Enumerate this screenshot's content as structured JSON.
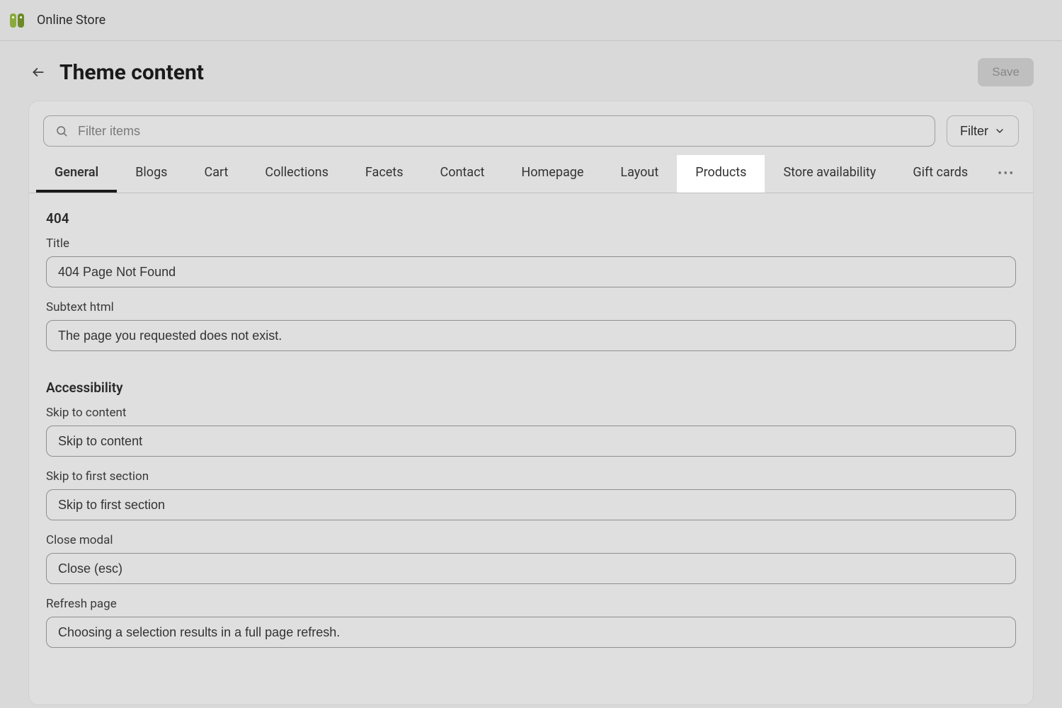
{
  "header": {
    "app_title": "Online Store"
  },
  "page": {
    "title": "Theme content",
    "save_label": "Save"
  },
  "filter": {
    "placeholder": "Filter items",
    "button_label": "Filter"
  },
  "tabs": [
    {
      "label": "General",
      "active": true
    },
    {
      "label": "Blogs"
    },
    {
      "label": "Cart"
    },
    {
      "label": "Collections"
    },
    {
      "label": "Facets"
    },
    {
      "label": "Contact"
    },
    {
      "label": "Homepage"
    },
    {
      "label": "Layout"
    },
    {
      "label": "Products",
      "highlighted": true
    },
    {
      "label": "Store availability"
    },
    {
      "label": "Gift cards"
    }
  ],
  "sections": {
    "s404": {
      "heading": "404",
      "title_label": "Title",
      "title_value": "404 Page Not Found",
      "subtext_label": "Subtext html",
      "subtext_value": "The page you requested does not exist."
    },
    "accessibility": {
      "heading": "Accessibility",
      "skip_content_label": "Skip to content",
      "skip_content_value": "Skip to content",
      "skip_first_label": "Skip to first section",
      "skip_first_value": "Skip to first section",
      "close_modal_label": "Close modal",
      "close_modal_value": "Close (esc)",
      "refresh_label": "Refresh page",
      "refresh_value": "Choosing a selection results in a full page refresh."
    }
  }
}
